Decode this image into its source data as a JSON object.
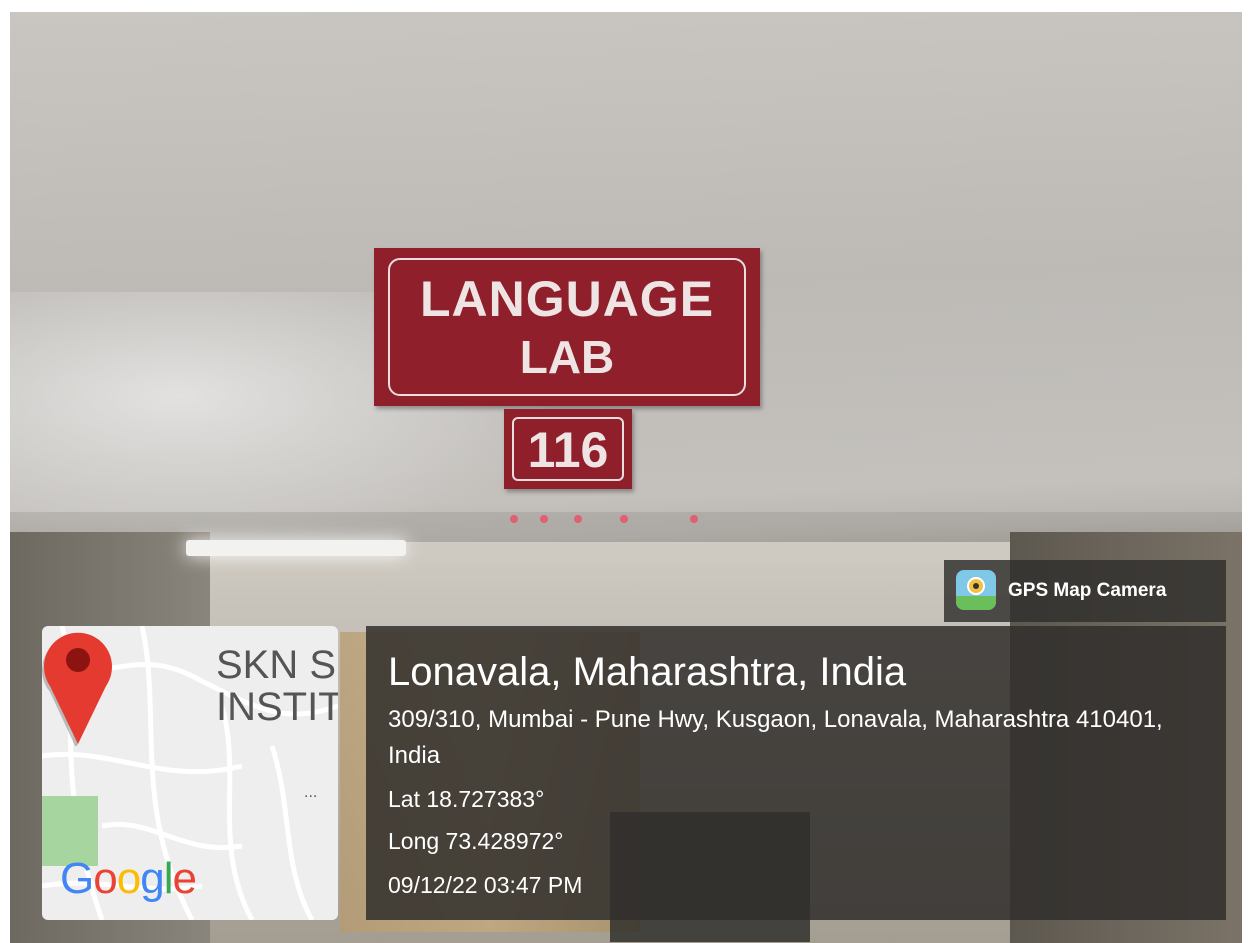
{
  "sign": {
    "line1": "LANGUAGE",
    "line2": "LAB",
    "room_number": "116",
    "color": "#8e1f2b"
  },
  "gps_badge": {
    "label": "GPS Map Camera",
    "icon": "gps-map-camera-app-icon"
  },
  "map": {
    "place_line1": "SKN SI",
    "place_line2": "INSTIT",
    "more": "...",
    "logo": [
      "G",
      "o",
      "o",
      "g",
      "l",
      "e"
    ],
    "logo_colors": [
      "#4285F4",
      "#EA4335",
      "#FBBC05",
      "#4285F4",
      "#34A853",
      "#EA4335"
    ],
    "pin_color": "#e53a30"
  },
  "location": {
    "title": "Lonavala, Maharashtra, India",
    "address": "309/310, Mumbai - Pune Hwy, Kusgaon, Lonavala, Maharashtra 410401, India",
    "latitude": "Lat 18.727383°",
    "longitude": "Long 73.428972°",
    "datetime": "09/12/22 03:47 PM"
  }
}
